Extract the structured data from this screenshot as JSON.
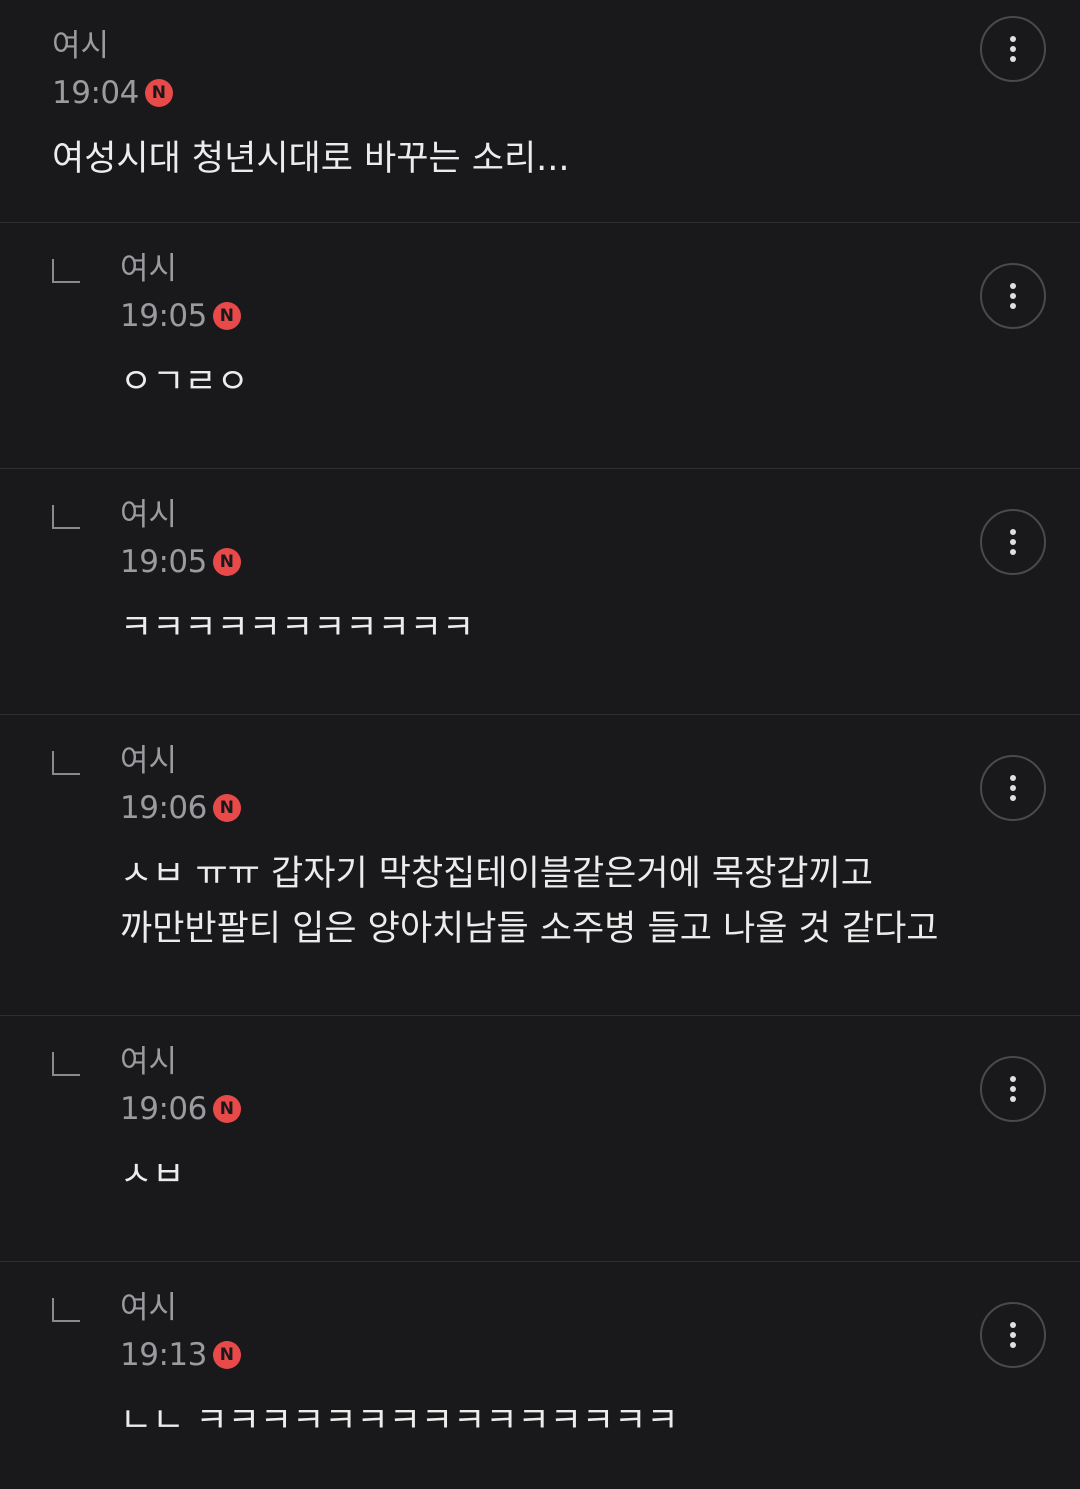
{
  "badge_letter": "N",
  "colors": {
    "background": "#19191b",
    "divider": "#2e2e31",
    "meta_text": "#9b9b9f",
    "body_text": "#ececec",
    "new_badge": "#e84a4a"
  },
  "comments": [
    {
      "author": "여시",
      "time": "19:04",
      "text": "여성시대 청년시대로 바꾸는 소리..."
    },
    {
      "author": "여시",
      "time": "19:05",
      "text": "ㅇㄱㄹㅇ"
    },
    {
      "author": "여시",
      "time": "19:05",
      "text": "ㅋㅋㅋㅋㅋㅋㅋㅋㅋㅋㅋ"
    },
    {
      "author": "여시",
      "time": "19:06",
      "text": "ㅅㅂ ㅠㅠ 갑자기 막창집테이블같은거에 목장갑끼고\n까만반팔티 입은 양아치남들 소주병 들고 나올 것 같다고"
    },
    {
      "author": "여시",
      "time": "19:06",
      "text": "ㅅㅂ"
    },
    {
      "author": "여시",
      "time": "19:13",
      "text": "ㄴㄴ ㅋㅋㅋㅋㅋㅋㅋㅋㅋㅋㅋㅋㅋㅋㅋ"
    }
  ]
}
